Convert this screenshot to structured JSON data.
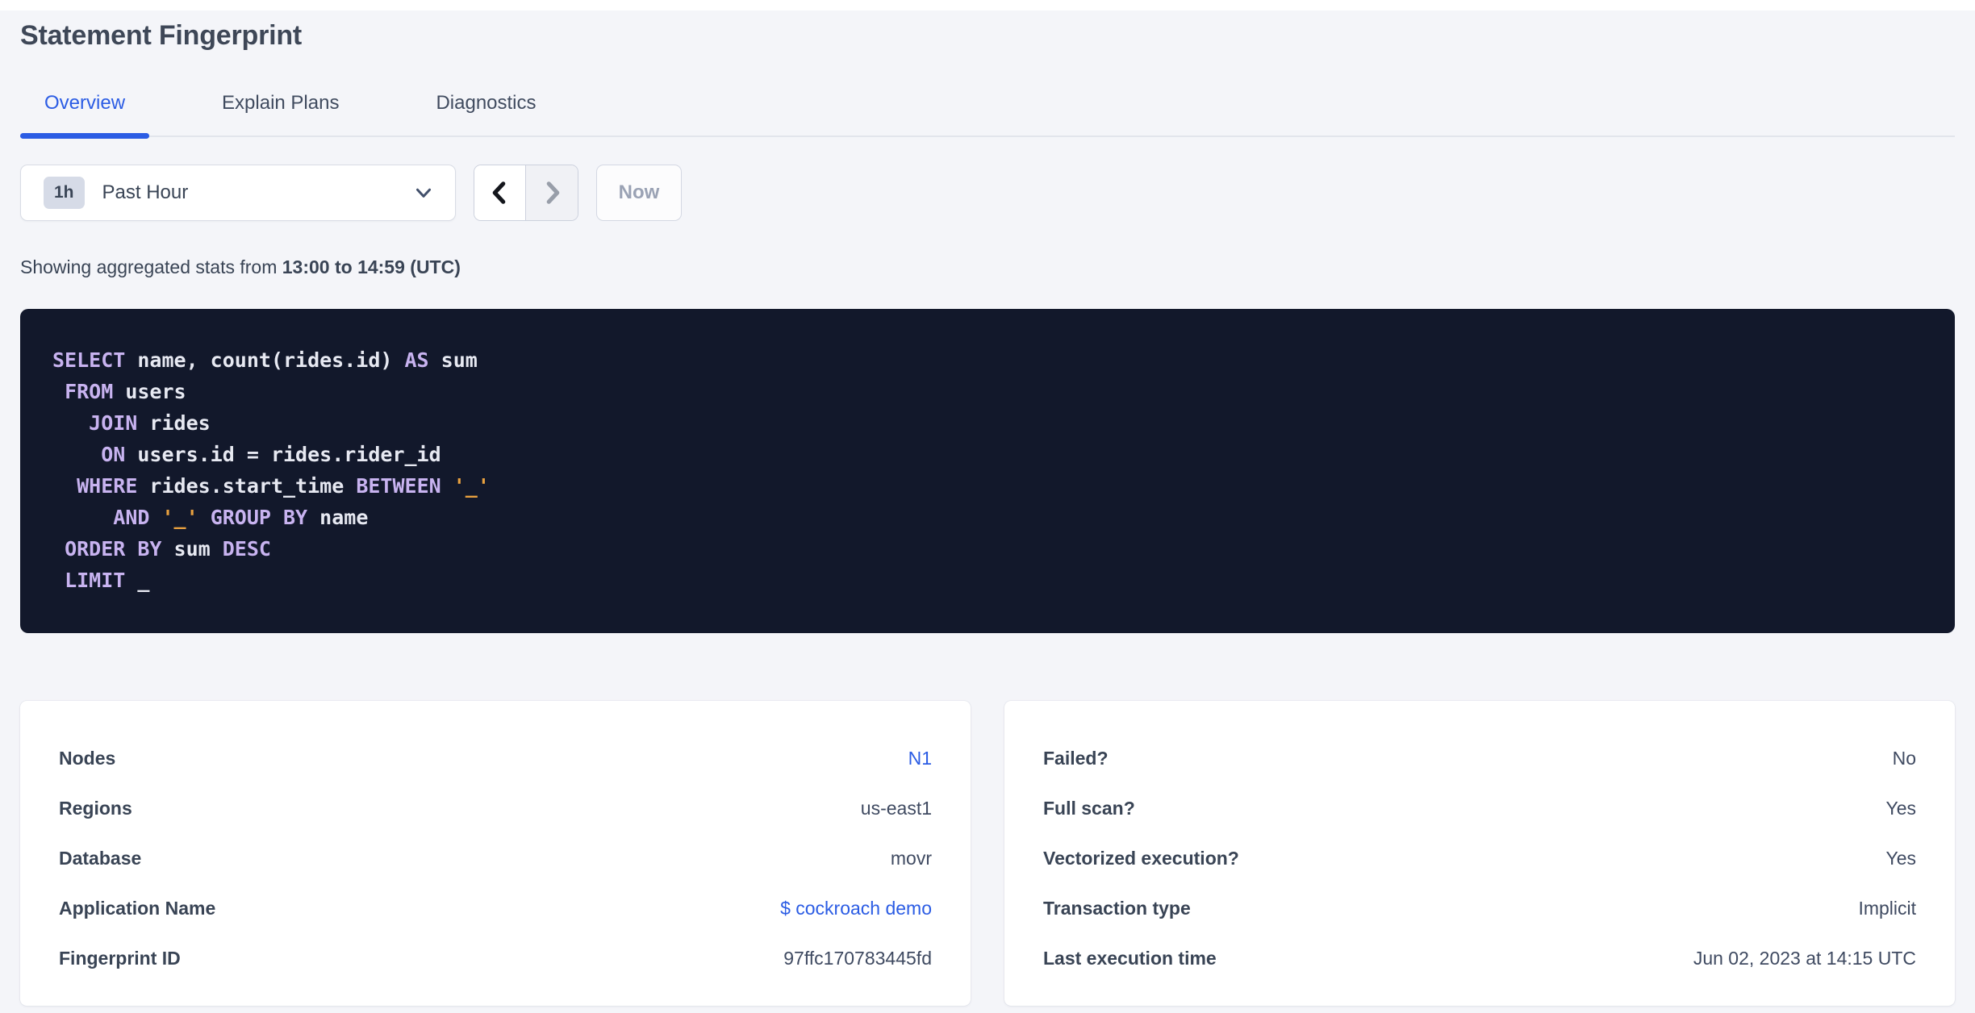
{
  "page": {
    "title": "Statement Fingerprint"
  },
  "tabs": [
    {
      "label": "Overview",
      "active": true
    },
    {
      "label": "Explain Plans",
      "active": false
    },
    {
      "label": "Diagnostics",
      "active": false
    }
  ],
  "time_picker": {
    "interval_badge": "1h",
    "selected_range": "Past Hour",
    "prev_icon": "chevron-left",
    "next_icon": "chevron-right",
    "caret_icon": "chevron-down",
    "now_label": "Now"
  },
  "stats_line": {
    "prefix": "Showing aggregated stats from ",
    "range_bold": "13:00 to 14:59 (UTC)"
  },
  "sql": {
    "lines": [
      [
        {
          "t": "SELECT",
          "c": "kw"
        },
        {
          "t": " name, count(rides.id) ",
          "c": "id"
        },
        {
          "t": "AS",
          "c": "kw"
        },
        {
          "t": " sum",
          "c": "id"
        }
      ],
      [
        {
          "t": " ",
          "c": "id"
        },
        {
          "t": "FROM",
          "c": "kw"
        },
        {
          "t": " users",
          "c": "id"
        }
      ],
      [
        {
          "t": "   ",
          "c": "id"
        },
        {
          "t": "JOIN",
          "c": "kw"
        },
        {
          "t": " rides",
          "c": "id"
        }
      ],
      [
        {
          "t": "    ",
          "c": "id"
        },
        {
          "t": "ON",
          "c": "kw"
        },
        {
          "t": " users.id = rides.rider_id",
          "c": "id"
        }
      ],
      [
        {
          "t": "  ",
          "c": "id"
        },
        {
          "t": "WHERE",
          "c": "kw"
        },
        {
          "t": " rides.start_time ",
          "c": "id"
        },
        {
          "t": "BETWEEN",
          "c": "kw"
        },
        {
          "t": " ",
          "c": "id"
        },
        {
          "t": "'_'",
          "c": "lit"
        }
      ],
      [
        {
          "t": "     ",
          "c": "id"
        },
        {
          "t": "AND",
          "c": "kw"
        },
        {
          "t": " ",
          "c": "id"
        },
        {
          "t": "'_'",
          "c": "lit"
        },
        {
          "t": " ",
          "c": "id"
        },
        {
          "t": "GROUP BY",
          "c": "kw"
        },
        {
          "t": " name",
          "c": "id"
        }
      ],
      [
        {
          "t": " ",
          "c": "id"
        },
        {
          "t": "ORDER BY",
          "c": "kw"
        },
        {
          "t": " sum ",
          "c": "id"
        },
        {
          "t": "DESC",
          "c": "kw"
        }
      ],
      [
        {
          "t": " ",
          "c": "id"
        },
        {
          "t": "LIMIT",
          "c": "kw"
        },
        {
          "t": " _",
          "c": "id"
        }
      ]
    ]
  },
  "cards": {
    "left": {
      "rows": [
        {
          "label": "Nodes",
          "value": "N1",
          "link": true
        },
        {
          "label": "Regions",
          "value": "us-east1",
          "link": false
        },
        {
          "label": "Database",
          "value": "movr",
          "link": false
        },
        {
          "label": "Application Name",
          "value": "$ cockroach demo",
          "link": true
        },
        {
          "label": "Fingerprint ID",
          "value": "97ffc170783445fd",
          "link": false
        }
      ]
    },
    "right": {
      "rows": [
        {
          "label": "Failed?",
          "value": "No",
          "link": false
        },
        {
          "label": "Full scan?",
          "value": "Yes",
          "link": false
        },
        {
          "label": "Vectorized execution?",
          "value": "Yes",
          "link": false
        },
        {
          "label": "Transaction type",
          "value": "Implicit",
          "link": false
        },
        {
          "label": "Last execution time",
          "value": "Jun 02, 2023 at 14:15 UTC",
          "link": false
        }
      ]
    }
  },
  "colors": {
    "accent_blue": "#2b5ce4",
    "page_bg": "#f4f5f9",
    "card_bg": "#ffffff",
    "sql_bg": "#12182b",
    "sql_keyword": "#c8b3f0",
    "sql_identifier": "#e7e9f2",
    "sql_literal": "#e9a13f",
    "text_dark": "#394455",
    "disabled_gray": "#9aa2b4"
  }
}
